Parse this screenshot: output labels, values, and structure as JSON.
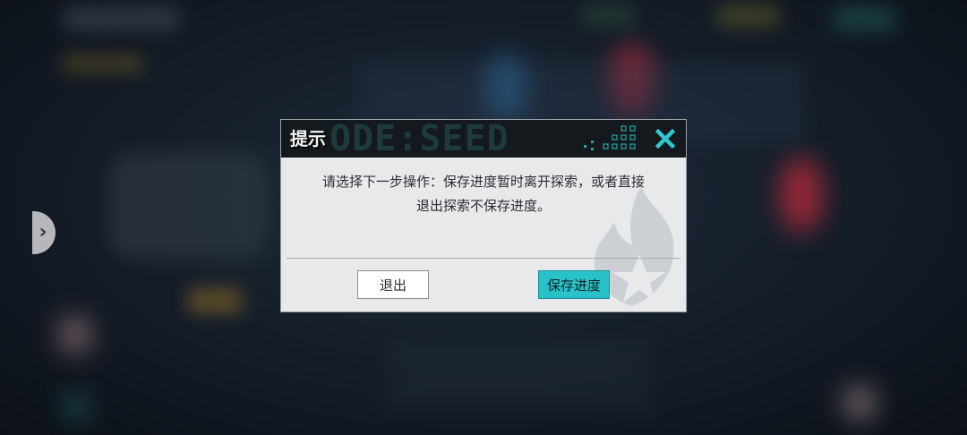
{
  "dialog": {
    "title": "提示",
    "header_watermark": "ODE:SEED",
    "message_line1": "请选择下一步操作：保存进度暂时离开探索，或者直接",
    "message_line2": "退出探索不保存进度。",
    "exit_label": "退出",
    "save_label": "保存进度",
    "close_icon": "close-icon",
    "accent_color": "#29c2c9"
  },
  "side_button": {
    "icon": "chevron-right-icon"
  }
}
